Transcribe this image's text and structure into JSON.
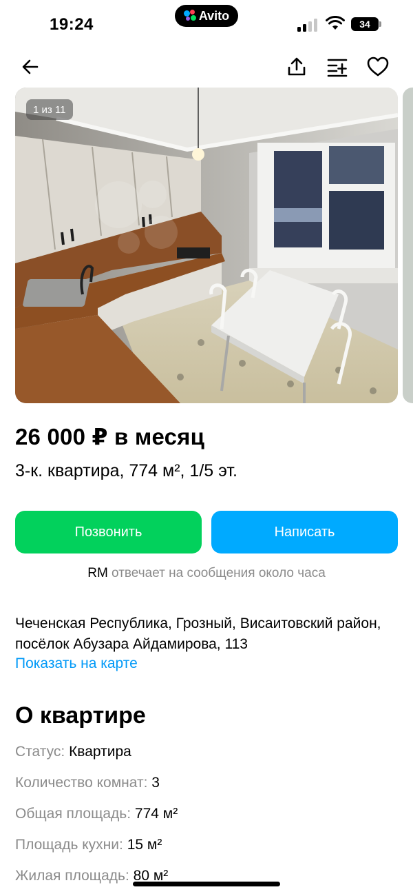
{
  "status_bar": {
    "time": "19:24",
    "app_badge": "Avito",
    "battery_level": "34"
  },
  "nav": {
    "back_icon": "arrow-left-icon",
    "share_icon": "share-icon",
    "compare_icon": "compare-list-icon",
    "favorite_icon": "heart-icon"
  },
  "gallery": {
    "counter": "1 из 11"
  },
  "listing": {
    "price": "26 000 ₽ в месяц",
    "title": "3-к. квартира, 774 м², 1/5 эт."
  },
  "actions": {
    "call_label": "Позвонить",
    "write_label": "Написать",
    "call_color": "#02d15c",
    "write_color": "#00aaff"
  },
  "reply_note": {
    "seller": "RM",
    "text": " отвечает на сообщения около часа"
  },
  "location": {
    "address": "Чеченская Республика, Грозный, Висаитовский район, посёлок Абузара Айдамирова, 113",
    "map_link": "Показать на карте"
  },
  "about": {
    "title": "О квартире",
    "params": [
      {
        "label": "Статус:",
        "value": "Квартира"
      },
      {
        "label": "Количество комнат:",
        "value": "3"
      },
      {
        "label": "Общая площадь:",
        "value": "774 м²"
      },
      {
        "label": "Площадь кухни:",
        "value": "15 м²"
      },
      {
        "label": "Жилая площадь:",
        "value": "80 м²"
      }
    ]
  }
}
